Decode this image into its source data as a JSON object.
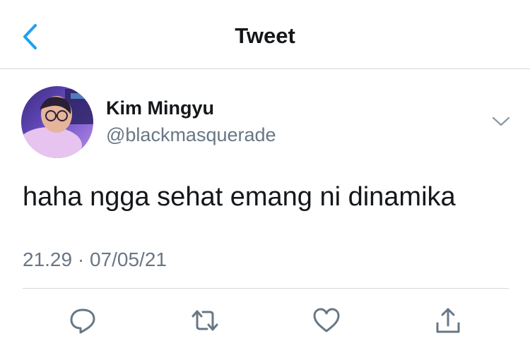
{
  "nav": {
    "title": "Tweet",
    "back_icon": "chevron-left-icon"
  },
  "tweet": {
    "author_name": "Kim Mingyu",
    "author_handle": "@blackmasquerade",
    "text": "haha ngga sehat emang ni dinamika",
    "time": "21.29",
    "separator": "·",
    "date": "07/05/21"
  },
  "actions": [
    "reply-icon",
    "retweet-icon",
    "like-icon",
    "share-icon"
  ],
  "colors": {
    "accent": "#1da1f2",
    "text_primary": "#14171a",
    "text_secondary": "#687785",
    "divider": "#d3d8dc"
  }
}
